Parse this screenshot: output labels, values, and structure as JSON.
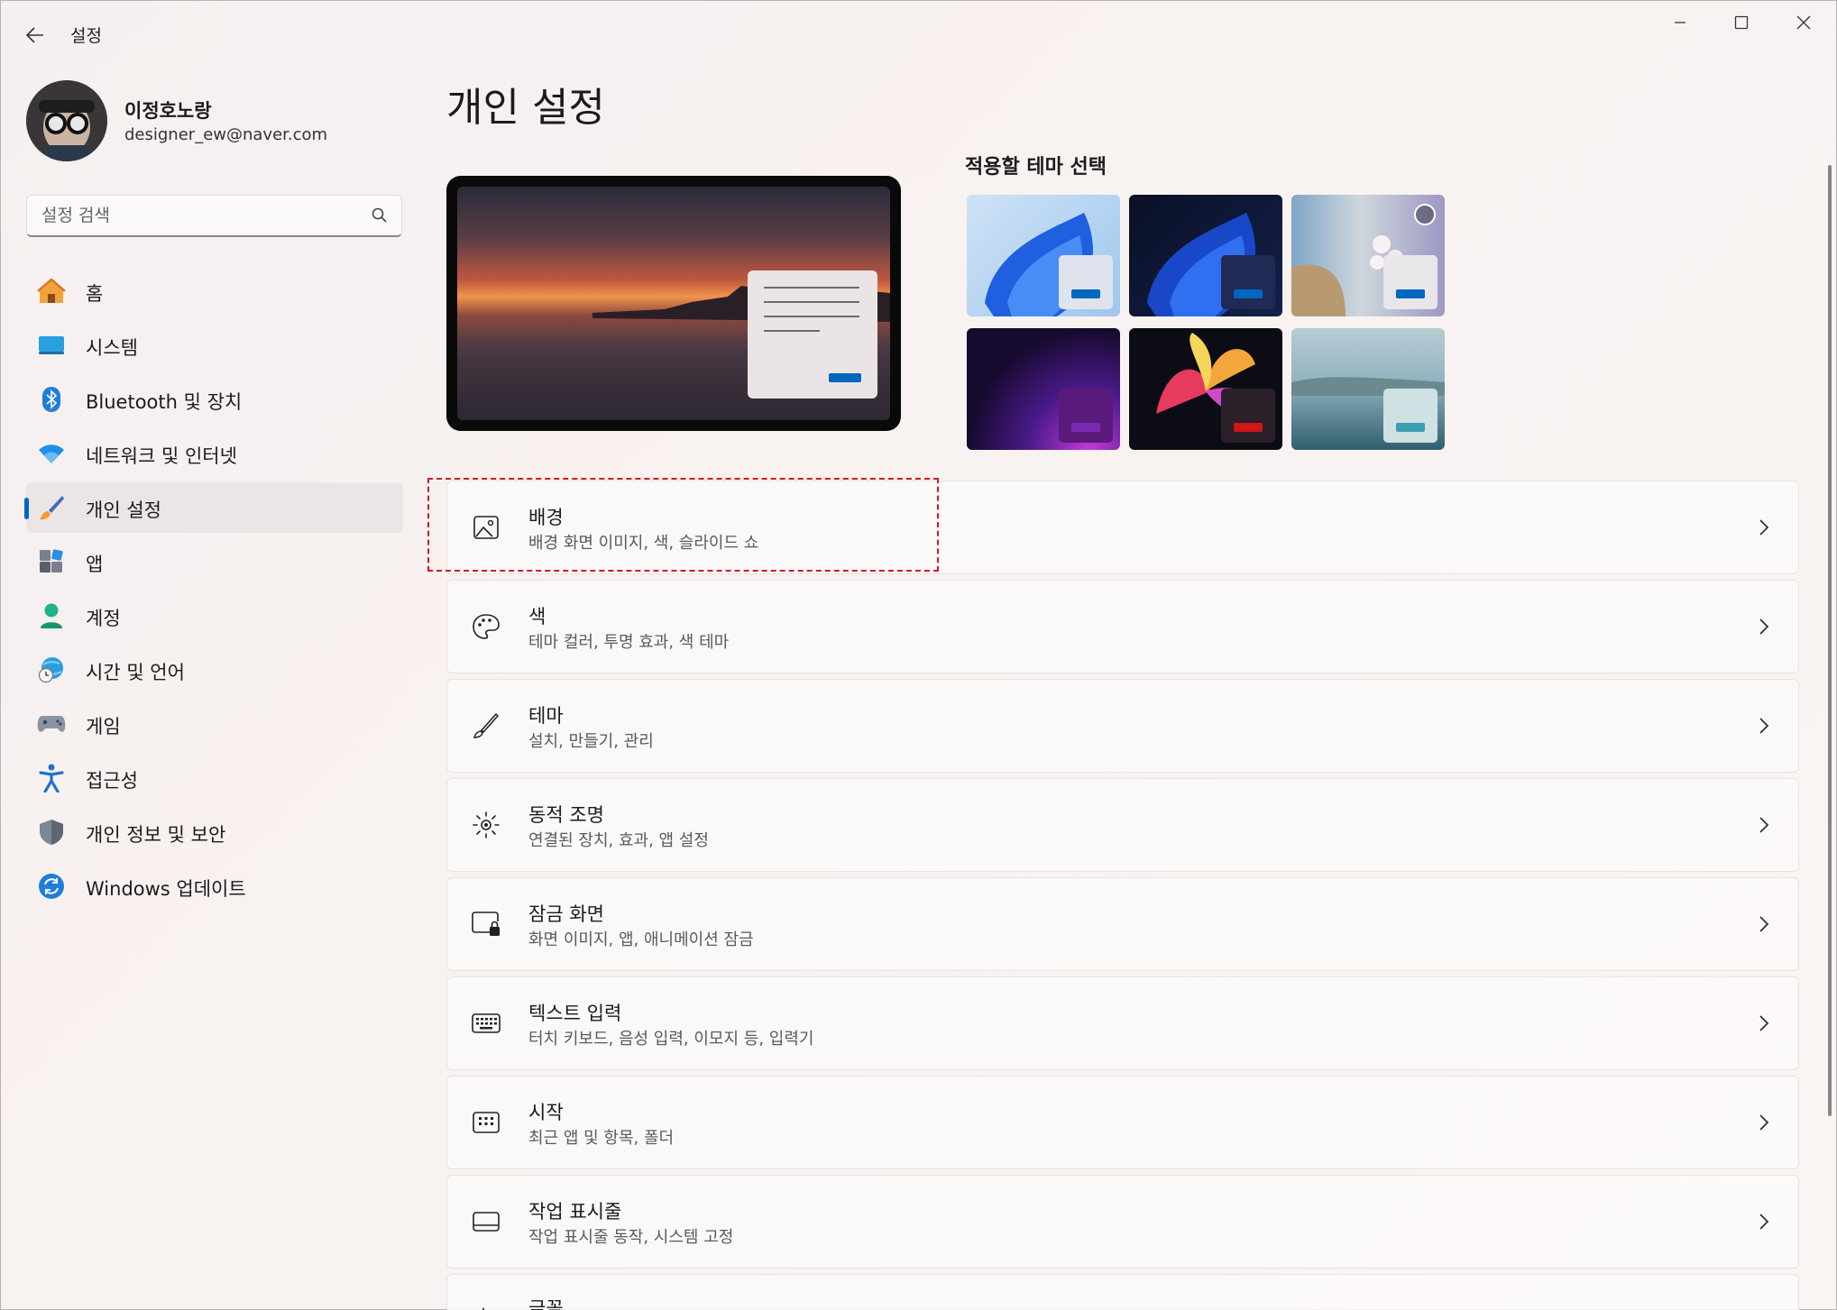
{
  "window": {
    "title": "설정"
  },
  "user": {
    "name": "이정호노랑",
    "email": "designer_ew@naver.com"
  },
  "search": {
    "placeholder": "설정 검색",
    "value": ""
  },
  "nav": {
    "items": [
      {
        "label": "홈",
        "icon": "home-icon",
        "active": false
      },
      {
        "label": "시스템",
        "icon": "system-icon",
        "active": false
      },
      {
        "label": "Bluetooth 및 장치",
        "icon": "bluetooth-icon",
        "active": false
      },
      {
        "label": "네트워크 및 인터넷",
        "icon": "wifi-icon",
        "active": false
      },
      {
        "label": "개인 설정",
        "icon": "brush-icon",
        "active": true
      },
      {
        "label": "앱",
        "icon": "apps-icon",
        "active": false
      },
      {
        "label": "계정",
        "icon": "account-icon",
        "active": false
      },
      {
        "label": "시간 및 언어",
        "icon": "globe-clock-icon",
        "active": false
      },
      {
        "label": "게임",
        "icon": "gamepad-icon",
        "active": false
      },
      {
        "label": "접근성",
        "icon": "accessibility-icon",
        "active": false
      },
      {
        "label": "개인 정보 및 보안",
        "icon": "shield-icon",
        "active": false
      },
      {
        "label": "Windows 업데이트",
        "icon": "update-icon",
        "active": false
      }
    ]
  },
  "main": {
    "title": "개인 설정",
    "themes_label": "적용할 테마 선택",
    "themes": [
      {
        "name": "windows-light",
        "chip": "#dfe3ee",
        "accent": "#0067c0"
      },
      {
        "name": "windows-dark",
        "chip": "#1f2a55",
        "accent": "#0067c0"
      },
      {
        "name": "spotlight",
        "chip": "#e9e6ea",
        "accent": "#0067c0"
      },
      {
        "name": "glow",
        "chip": "#5a1a7a",
        "accent": "#7a2ab0"
      },
      {
        "name": "captured-motion",
        "chip": "#2b1f2a",
        "accent": "#d01616"
      },
      {
        "name": "flow",
        "chip": "#cfe1e3",
        "accent": "#3aa0b0"
      }
    ],
    "cards": [
      {
        "title": "배경",
        "subtitle": "배경 화면 이미지, 색, 슬라이드 쇼",
        "icon": "image-icon"
      },
      {
        "title": "색",
        "subtitle": "테마 컬러, 투명 효과, 색 테마",
        "icon": "palette-icon"
      },
      {
        "title": "테마",
        "subtitle": "설치, 만들기, 관리",
        "icon": "brush-icon"
      },
      {
        "title": "동적 조명",
        "subtitle": "연결된 장치, 효과, 앱 설정",
        "icon": "dynamic-lighting-icon"
      },
      {
        "title": "잠금 화면",
        "subtitle": "화면 이미지, 앱, 애니메이션 잠금",
        "icon": "lock-screen-icon"
      },
      {
        "title": "텍스트 입력",
        "subtitle": "터치 키보드, 음성 입력, 이모지 등, 입력기",
        "icon": "keyboard-icon"
      },
      {
        "title": "시작",
        "subtitle": "최근 앱 및 항목, 폴더",
        "icon": "start-icon"
      },
      {
        "title": "작업 표시줄",
        "subtitle": "작업 표시줄 동작, 시스템 고정",
        "icon": "taskbar-icon"
      },
      {
        "title": "글꼴",
        "subtitle": "",
        "icon": "font-icon"
      }
    ]
  },
  "colors": {
    "accent": "#0067c0",
    "highlight": "#d11b1b"
  }
}
